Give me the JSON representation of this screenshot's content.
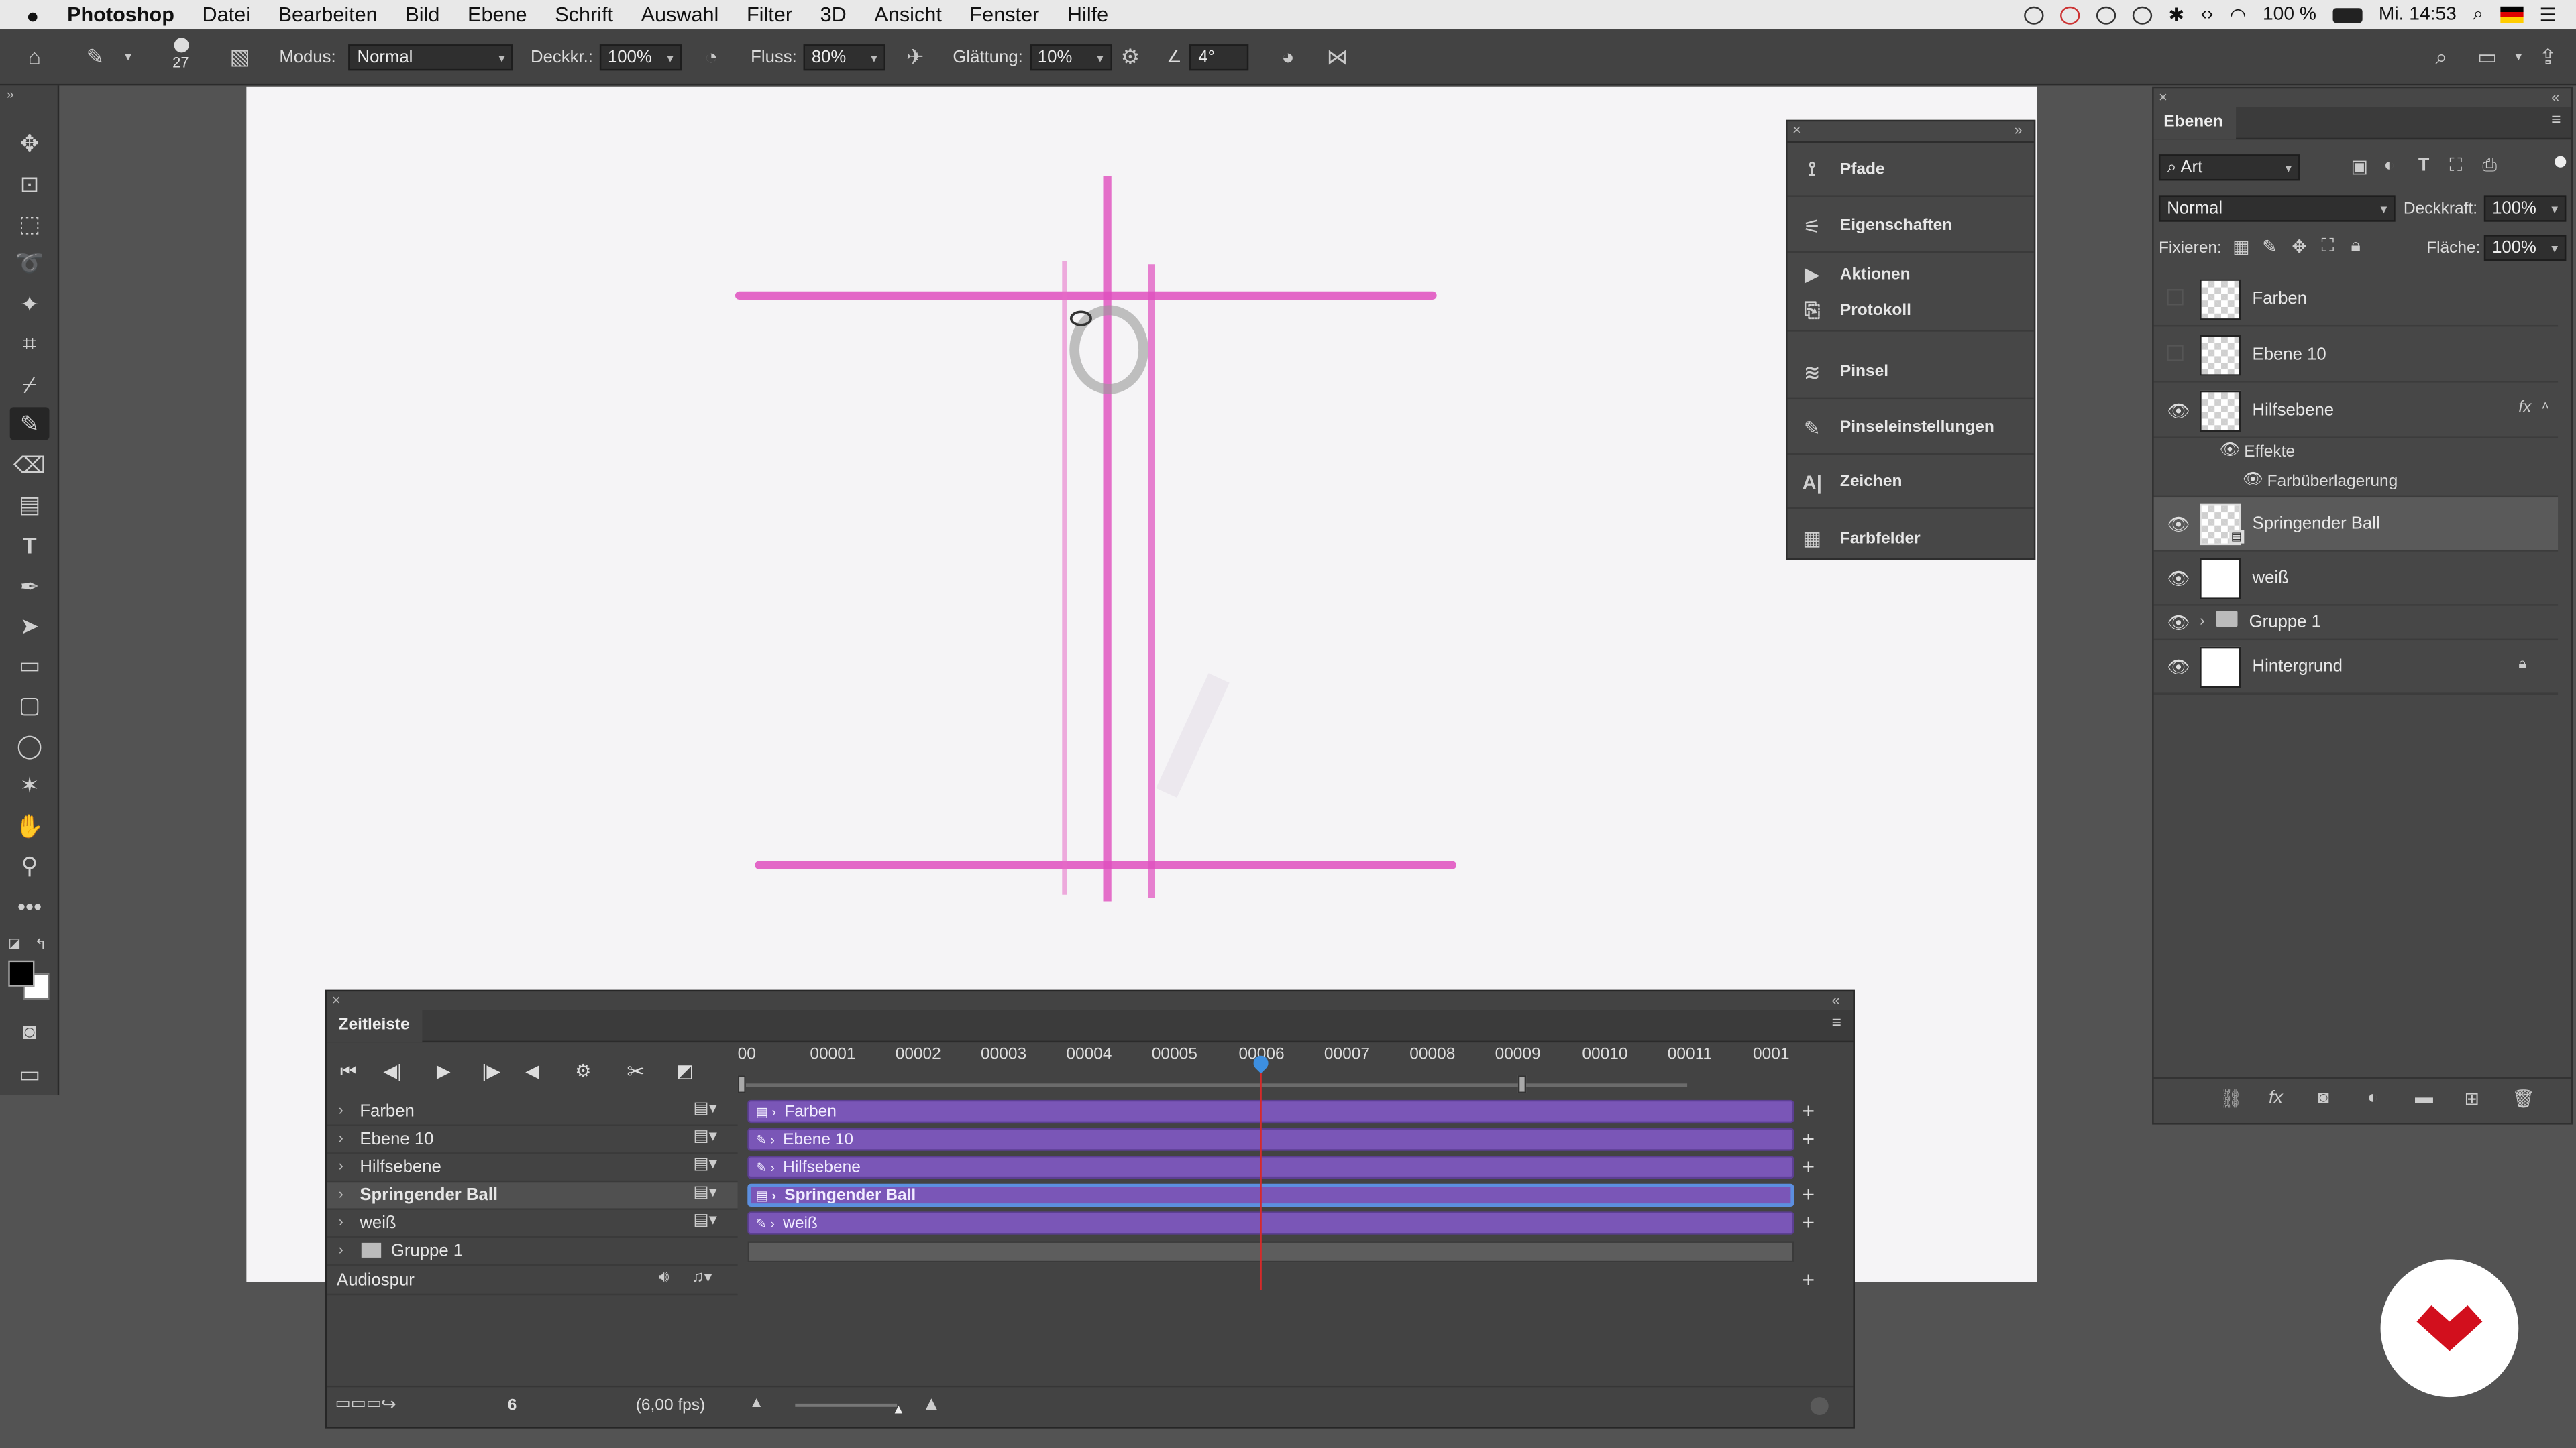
{
  "menubar": {
    "apple": "",
    "app": "Photoshop",
    "items": [
      "Datei",
      "Bearbeiten",
      "Bild",
      "Ebene",
      "Schrift",
      "Auswahl",
      "Filter",
      "3D",
      "Ansicht",
      "Fenster",
      "Hilfe"
    ],
    "battery": "100 %",
    "clock": "Mi. 14:53"
  },
  "options": {
    "brush_size": "27",
    "mode_label": "Modus:",
    "mode_value": "Normal",
    "opacity_label": "Deckkr.:",
    "opacity_value": "100%",
    "flow_label": "Fluss:",
    "flow_value": "80%",
    "smoothing_label": "Glättung:",
    "smoothing_value": "10%",
    "angle_value": "4°"
  },
  "float_panel": {
    "items": [
      "Pfade",
      "Eigenschaften",
      "Aktionen",
      "Protokoll",
      "Pinsel",
      "Pinseleinstellungen",
      "Zeichen",
      "Farbfelder"
    ]
  },
  "layers": {
    "tab": "Ebenen",
    "filter": "Art",
    "blend": "Normal",
    "opacity_label": "Deckkraft:",
    "opacity_value": "100%",
    "lock_label": "Fixieren:",
    "fill_label": "Fläche:",
    "fill_value": "100%",
    "rows": [
      "Farben",
      "Ebene 10",
      "Hilfsebene",
      "Springender Ball",
      "weiß",
      "Gruppe 1",
      "Hintergrund"
    ],
    "effects_label": "Effekte",
    "effect_item": "Farbüberlagerung",
    "fx": "fx"
  },
  "timeline": {
    "title": "Zeitleiste",
    "ticks": [
      "00",
      "00001",
      "00002",
      "00003",
      "00004",
      "00005",
      "00006",
      "00007",
      "00008",
      "00009",
      "00010",
      "00011",
      "0001"
    ],
    "tracks": [
      "Farben",
      "Ebene 10",
      "Hilfsebene",
      "Springender Ball",
      "weiß",
      "Gruppe 1"
    ],
    "audio": "Audiospur",
    "frame": "6",
    "fps": "(6,00 fps)"
  }
}
